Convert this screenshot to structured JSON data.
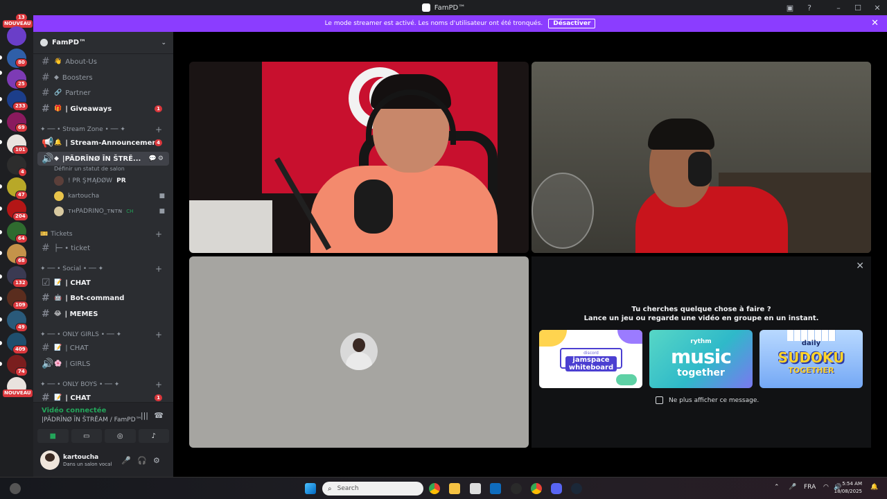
{
  "window": {
    "title": "FamPD™"
  },
  "banner": {
    "text": "Le mode streamer est activé. Les noms d'utilisateur ont été tronqués.",
    "button": "Désactiver"
  },
  "rail": {
    "new_label": "NOUVEAU",
    "badges": [
      "13",
      "80",
      "25",
      "233",
      "69",
      "101",
      "4",
      "47",
      "204",
      "64",
      "68",
      "132",
      "109",
      "49",
      "409",
      "74"
    ]
  },
  "server": {
    "name": "FamPD™"
  },
  "channels": {
    "about": "About-Us",
    "boosters": "Boosters",
    "partner": "Partner",
    "giveaways": "| Giveaways",
    "giveaways_count": "1",
    "cat_stream": "✦ ── • Stream Zone • ── ✦",
    "stream_announcement": "| Stream-Announcement",
    "stream_announcement_count": "4",
    "voice_channel": "|PÃDRĨNØ ĨN ŠTRĚ...",
    "voice_status": "Définir un statut de salon",
    "voice_users": [
      {
        "name": "! PR ŞĦĄĐØW",
        "tag": "PR"
      },
      {
        "name": "kartoucha",
        "tag": ""
      },
      {
        "name": "ᴛʜPADRINO_ᴛɴᴛɴ",
        "tag": "CH"
      }
    ],
    "cat_tickets": "Tickets",
    "ticket": "├─ • ticket",
    "cat_social": "✦ ── • Social • ── ✦",
    "chat": "| CHAT",
    "bot_command": "| Bot-command",
    "memes": "| MEMES",
    "cat_girls": "✦ ── • ONLY GIRLS • ── ✦",
    "chat_girls": "| CHAT",
    "girls": "| GIRLS",
    "cat_boys": "✦ ── • ONLY BOYS • ── ✦",
    "chat_boys": "| CHAT",
    "chat_boys_count": "1"
  },
  "voice_panel": {
    "status": "Vidéo connectée",
    "channel": "|PÃDRĨNØ ĨN ŠTRĚAM / FamPD™"
  },
  "user_panel": {
    "name": "kartoucha",
    "status": "Dans un salon vocal"
  },
  "activity": {
    "title": "Tu cherches quelque chose à faire ?",
    "subtitle": "Lance un jeu ou regarde une vidéo en groupe en un instant.",
    "cards": [
      {
        "top": "discord",
        "main": "jamspace whiteboard"
      },
      {
        "brand": "rythm",
        "main": "music",
        "sub": "together"
      },
      {
        "top": "daily",
        "main": "SUDOKU",
        "sub": "TOGETHER"
      }
    ],
    "checkbox": "Ne plus afficher ce message."
  },
  "taskbar": {
    "search": "Search",
    "lang": "FRA",
    "time": "5:54 AM",
    "date": "18/08/2025"
  },
  "colors": {
    "accent": "#8b3dff",
    "danger": "#da373c",
    "online": "#23a55a"
  }
}
